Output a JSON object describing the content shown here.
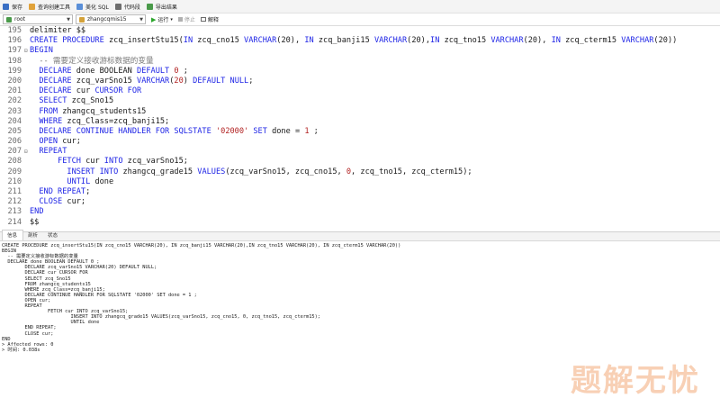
{
  "toolbar": {
    "items": [
      {
        "label": "保存",
        "icon": "save-icon",
        "color": "#3a6fc4"
      },
      {
        "label": "查询创建工具",
        "icon": "query-builder-icon",
        "color": "#e0a23a"
      },
      {
        "label": "美化 SQL",
        "icon": "beautify-icon",
        "color": "#5a8fd8"
      },
      {
        "label": "代码段",
        "icon": "code-snippet-icon",
        "color": "#6d6d6d"
      },
      {
        "label": "导出结果",
        "icon": "export-icon",
        "color": "#4a9a4a"
      }
    ]
  },
  "connection": {
    "connection_value": "root",
    "database_value": "zhangcqmis15",
    "run_label": "运行",
    "stop_label": "停止",
    "explain_label": "解释"
  },
  "editor": {
    "lines": [
      {
        "num": "195",
        "fold": "",
        "segs": [
          {
            "t": "delimiter $$",
            "c": ""
          }
        ]
      },
      {
        "num": "196",
        "fold": "",
        "segs": [
          {
            "t": "CREATE PROCEDURE",
            "c": "kw"
          },
          {
            "t": " zcq_insertStu15(",
            "c": ""
          },
          {
            "t": "IN",
            "c": "kw"
          },
          {
            "t": " zcq_cno15 ",
            "c": ""
          },
          {
            "t": "VARCHAR",
            "c": "kw"
          },
          {
            "t": "(20), ",
            "c": ""
          },
          {
            "t": "IN",
            "c": "kw"
          },
          {
            "t": " zcq_banji15 ",
            "c": ""
          },
          {
            "t": "VARCHAR",
            "c": "kw"
          },
          {
            "t": "(20),",
            "c": ""
          },
          {
            "t": "IN",
            "c": "kw"
          },
          {
            "t": " zcq_tno15 ",
            "c": ""
          },
          {
            "t": "VARCHAR",
            "c": "kw"
          },
          {
            "t": "(20), ",
            "c": ""
          },
          {
            "t": "IN",
            "c": "kw"
          },
          {
            "t": " zcq_cterm15 ",
            "c": ""
          },
          {
            "t": "VARCHAR",
            "c": "kw"
          },
          {
            "t": "(20))",
            "c": ""
          }
        ]
      },
      {
        "num": "197",
        "fold": "⊟",
        "segs": [
          {
            "t": "BEGIN",
            "c": "kw"
          }
        ]
      },
      {
        "num": "198",
        "fold": "",
        "segs": [
          {
            "t": "  -- 需要定义接收游标数据的变量",
            "c": "cm"
          }
        ]
      },
      {
        "num": "199",
        "fold": "",
        "segs": [
          {
            "t": "  DECLARE",
            "c": "kw"
          },
          {
            "t": " done BOOLEAN ",
            "c": ""
          },
          {
            "t": "DEFAULT",
            "c": "kw"
          },
          {
            "t": " ",
            "c": ""
          },
          {
            "t": "0",
            "c": "str"
          },
          {
            "t": " ;",
            "c": ""
          }
        ]
      },
      {
        "num": "200",
        "fold": "",
        "segs": [
          {
            "t": "  DECLARE",
            "c": "kw"
          },
          {
            "t": " zcq_varSno15 ",
            "c": ""
          },
          {
            "t": "VARCHAR",
            "c": "kw"
          },
          {
            "t": "(",
            "c": ""
          },
          {
            "t": "20",
            "c": "str"
          },
          {
            "t": ") ",
            "c": ""
          },
          {
            "t": "DEFAULT NULL",
            "c": "kw"
          },
          {
            "t": ";",
            "c": ""
          }
        ]
      },
      {
        "num": "201",
        "fold": "",
        "segs": [
          {
            "t": "  DECLARE",
            "c": "kw"
          },
          {
            "t": " cur ",
            "c": ""
          },
          {
            "t": "CURSOR FOR",
            "c": "kw"
          }
        ]
      },
      {
        "num": "202",
        "fold": "",
        "segs": [
          {
            "t": "  SELECT",
            "c": "kw"
          },
          {
            "t": " zcq_Sno15",
            "c": ""
          }
        ]
      },
      {
        "num": "203",
        "fold": "",
        "segs": [
          {
            "t": "  FROM",
            "c": "kw"
          },
          {
            "t": " zhangcq_students15",
            "c": ""
          }
        ]
      },
      {
        "num": "204",
        "fold": "",
        "segs": [
          {
            "t": "  WHERE",
            "c": "kw"
          },
          {
            "t": " zcq_Class=zcq_banji15;",
            "c": ""
          }
        ]
      },
      {
        "num": "205",
        "fold": "",
        "segs": [
          {
            "t": "  DECLARE CONTINUE HANDLER FOR SQLSTATE",
            "c": "kw"
          },
          {
            "t": " ",
            "c": ""
          },
          {
            "t": "'02000'",
            "c": "str"
          },
          {
            "t": " ",
            "c": ""
          },
          {
            "t": "SET",
            "c": "kw"
          },
          {
            "t": " done = ",
            "c": ""
          },
          {
            "t": "1",
            "c": "str"
          },
          {
            "t": " ;",
            "c": ""
          }
        ]
      },
      {
        "num": "206",
        "fold": "",
        "segs": [
          {
            "t": "  OPEN",
            "c": "kw"
          },
          {
            "t": " cur;",
            "c": ""
          }
        ]
      },
      {
        "num": "207",
        "fold": "⊟",
        "segs": [
          {
            "t": "  REPEAT",
            "c": "kw"
          }
        ]
      },
      {
        "num": "208",
        "fold": "",
        "segs": [
          {
            "t": "      FETCH",
            "c": "kw"
          },
          {
            "t": " cur ",
            "c": ""
          },
          {
            "t": "INTO",
            "c": "kw"
          },
          {
            "t": " zcq_varSno15;",
            "c": ""
          }
        ]
      },
      {
        "num": "209",
        "fold": "",
        "segs": [
          {
            "t": "        INSERT INTO",
            "c": "kw"
          },
          {
            "t": " zhangcq_grade15 ",
            "c": ""
          },
          {
            "t": "VALUES",
            "c": "kw"
          },
          {
            "t": "(zcq_varSno15, zcq_cno15, ",
            "c": ""
          },
          {
            "t": "0",
            "c": "str"
          },
          {
            "t": ", zcq_tno15, zcq_cterm15);",
            "c": ""
          }
        ]
      },
      {
        "num": "210",
        "fold": "",
        "segs": [
          {
            "t": "        UNTIL",
            "c": "kw"
          },
          {
            "t": " done",
            "c": ""
          }
        ]
      },
      {
        "num": "211",
        "fold": "",
        "segs": [
          {
            "t": "  END REPEAT",
            "c": "kw"
          },
          {
            "t": ";",
            "c": ""
          }
        ]
      },
      {
        "num": "212",
        "fold": "",
        "segs": [
          {
            "t": "  CLOSE",
            "c": "kw"
          },
          {
            "t": " cur;",
            "c": ""
          }
        ]
      },
      {
        "num": "213",
        "fold": "",
        "segs": [
          {
            "t": "END",
            "c": "kw"
          }
        ]
      },
      {
        "num": "214",
        "fold": "",
        "segs": [
          {
            "t": "$$",
            "c": ""
          }
        ]
      }
    ]
  },
  "result": {
    "tabs": [
      "信息",
      "剖析",
      "状态"
    ],
    "active_tab": 0,
    "lines": [
      "CREATE PROCEDURE zcq_insertStu15(IN zcq_cno15 VARCHAR(20), IN zcq_banji15 VARCHAR(20),IN zcq_tno15 VARCHAR(20), IN zcq_cterm15 VARCHAR(20))",
      "BEGIN",
      "  -- 需要定义接收游标数据的变量",
      "  DECLARE done BOOLEAN DEFAULT 0 ;",
      "        DECLARE zcq_varSno15 VARCHAR(20) DEFAULT NULL;",
      "        DECLARE cur CURSOR FOR",
      "        SELECT zcq_Sno15",
      "        FROM zhangcq_students15",
      "        WHERE zcq_Class=zcq_banji15;",
      "        DECLARE CONTINUE HANDLER FOR SQLSTATE '02000' SET done = 1 ;",
      "        OPEN cur;",
      "        REPEAT",
      "                FETCH cur INTO zcq_varSno15;",
      "                        INSERT INTO zhangcq_grade15 VALUES(zcq_varSno15, zcq_cno15, 0, zcq_tno15, zcq_cterm15);",
      "                        UNTIL done",
      "        END REPEAT;",
      "        CLOSE cur;",
      "END",
      "> Affected rows: 0",
      "> 时间: 0.038s"
    ]
  },
  "watermark": "题解无忧",
  "colors": {
    "keyword": "#1f25e6",
    "string": "#b22222",
    "comment": "#7a7a7a",
    "accent": "#2aa52a"
  }
}
